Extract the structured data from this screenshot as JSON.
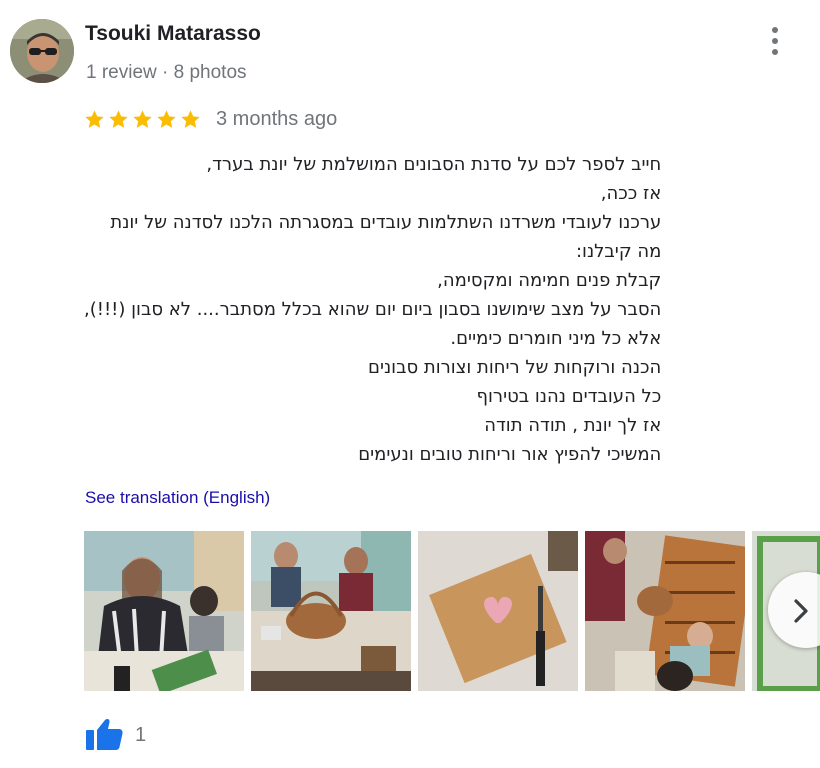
{
  "reviewer": {
    "name": "Tsouki Matarasso",
    "meta": "1 review · 8 photos"
  },
  "rating": {
    "stars": 5,
    "date": "3 months ago",
    "star_color": "#fbbc04"
  },
  "review": {
    "lines": [
      "חייב לספר לכם על סדנת הסבונים המושלמת של יונת בערד,",
      "אז ככה,",
      "ערכנו לעובדי משרדנו השתלמות עובדים במסגרתה הלכנו לסדנה של יונת",
      "מה קיבלנו:",
      "קבלת פנים חמימה ומקסימה,",
      "הסבר על מצב שימושנו בסבון ביום יום שהוא בכלל מסתבר.... לא סבון (!!!),",
      "אלא כל מיני חומרים כימיים.",
      "הכנה ורוקחות של ריחות וצורות סבונים",
      "כל העובדים נהנו בטירוף",
      "אז לך יונת , תודה תודה",
      "המשיכי להפיץ אור וריחות טובים ונעימים"
    ],
    "translate_label": "See translation (English)"
  },
  "photos": [
    {
      "name": "photo-woman-crafting"
    },
    {
      "name": "photo-table-basket"
    },
    {
      "name": "photo-heart-soap-board"
    },
    {
      "name": "photo-group-shelves"
    },
    {
      "name": "photo-partial"
    }
  ],
  "likes": {
    "count": "1",
    "color": "#1a73e8"
  }
}
